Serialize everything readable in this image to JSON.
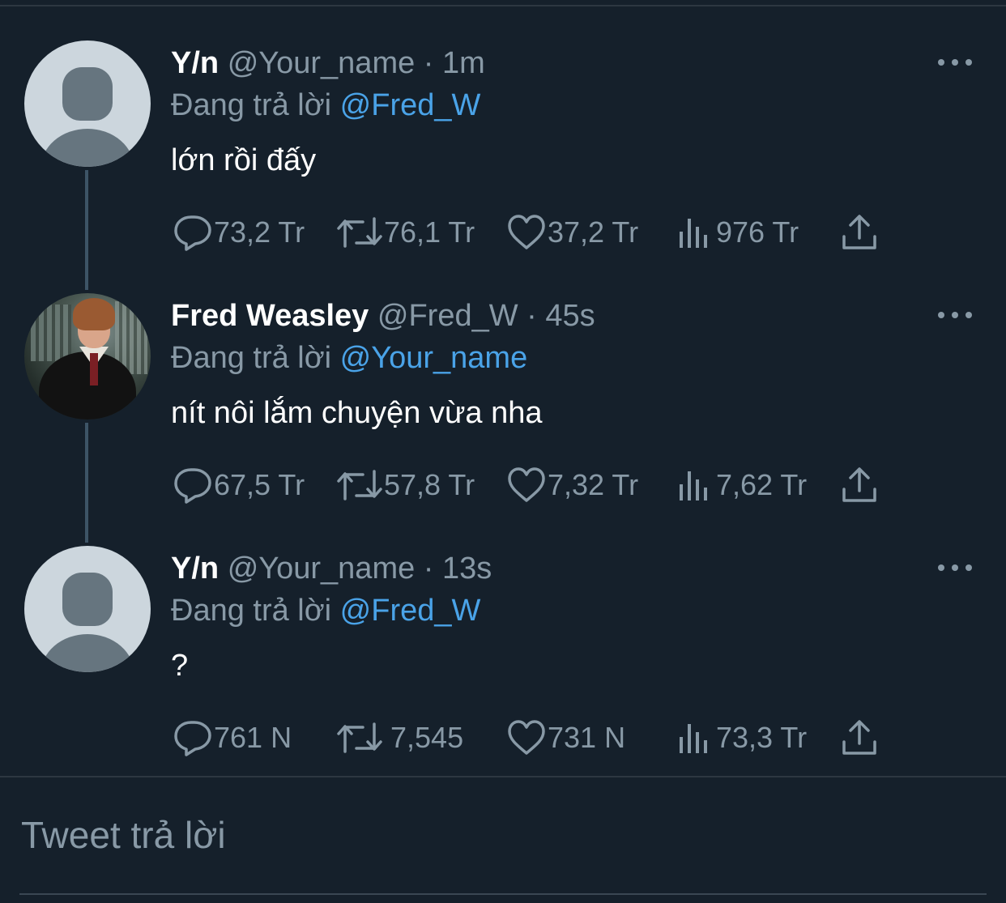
{
  "tweets": [
    {
      "name": "Y/n",
      "handle": "@Your_name",
      "separator": "·",
      "time": "1m",
      "replying_prefix": "Đang trả lời",
      "replying_to": "@Fred_W",
      "text": "lớn rồi đấy",
      "avatar": "default-avatar",
      "replies": "73,2 Tr",
      "retweets": "76,1 Tr",
      "likes": "37,2 Tr",
      "views": "976 Tr"
    },
    {
      "name": "Fred Weasley",
      "handle": "@Fred_W",
      "separator": "·",
      "time": "45s",
      "replying_prefix": "Đang trả lời",
      "replying_to": "@Your_name",
      "text": "nít nôi lắm chuyện vừa nha",
      "avatar": "photo-avatar",
      "replies": "67,5 Tr",
      "retweets": "57,8 Tr",
      "likes": "7,32 Tr",
      "views": "7,62 Tr"
    },
    {
      "name": "Y/n",
      "handle": "@Your_name",
      "separator": "·",
      "time": "13s",
      "replying_prefix": "Đang trả lời",
      "replying_to": "@Fred_W",
      "text": "?",
      "avatar": "default-avatar",
      "replies": "761 N",
      "retweets": "7,545",
      "likes": "731 N",
      "views": "73,3 Tr"
    }
  ],
  "reply_box": {
    "placeholder": "Tweet trả lời"
  },
  "colors": {
    "background": "#15202b",
    "text_primary": "#ffffff",
    "text_secondary": "#8899a6",
    "link": "#4aa3e8"
  },
  "icons": [
    "reply-icon",
    "retweet-icon",
    "like-icon",
    "views-icon",
    "share-icon",
    "more-icon"
  ]
}
